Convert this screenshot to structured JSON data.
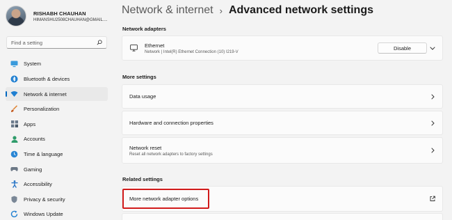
{
  "profile": {
    "name": "RISHABH CHAUHAN",
    "email": "HIMANSHU2508CHAUHAN@GMAIL...."
  },
  "search": {
    "placeholder": "Find a setting",
    "icon": "search-icon"
  },
  "sidebar": {
    "items": [
      {
        "label": "System",
        "icon": "monitor-icon",
        "active": false
      },
      {
        "label": "Bluetooth & devices",
        "icon": "bluetooth-icon",
        "active": false
      },
      {
        "label": "Network & internet",
        "icon": "wifi-icon",
        "active": true
      },
      {
        "label": "Personalization",
        "icon": "brush-icon",
        "active": false
      },
      {
        "label": "Apps",
        "icon": "apps-icon",
        "active": false
      },
      {
        "label": "Accounts",
        "icon": "person-icon",
        "active": false
      },
      {
        "label": "Time & language",
        "icon": "globe-clock-icon",
        "active": false
      },
      {
        "label": "Gaming",
        "icon": "gamepad-icon",
        "active": false
      },
      {
        "label": "Accessibility",
        "icon": "accessibility-icon",
        "active": false
      },
      {
        "label": "Privacy & security",
        "icon": "shield-icon",
        "active": false
      },
      {
        "label": "Windows Update",
        "icon": "update-icon",
        "active": false
      }
    ]
  },
  "header": {
    "parent": "Network & internet",
    "separator": "›",
    "current": "Advanced network settings"
  },
  "sections": {
    "adapters": "Network adapters",
    "more": "More settings",
    "related": "Related settings"
  },
  "ethernet": {
    "title": "Ethernet",
    "subtitle": "Network | Intel(R) Ethernet Connection (10) I219-V",
    "button": "Disable"
  },
  "more_settings": [
    {
      "title": "Data usage"
    },
    {
      "title": "Hardware and connection properties"
    },
    {
      "title": "Network reset",
      "subtitle": "Reset all network adapters to factory settings"
    }
  ],
  "related_settings": [
    {
      "title": "More network adapter options"
    }
  ],
  "colors": {
    "accent": "#0067c0",
    "highlight": "#d11a1a",
    "background": "#f3f3f3",
    "card": "#fbfbfb"
  }
}
